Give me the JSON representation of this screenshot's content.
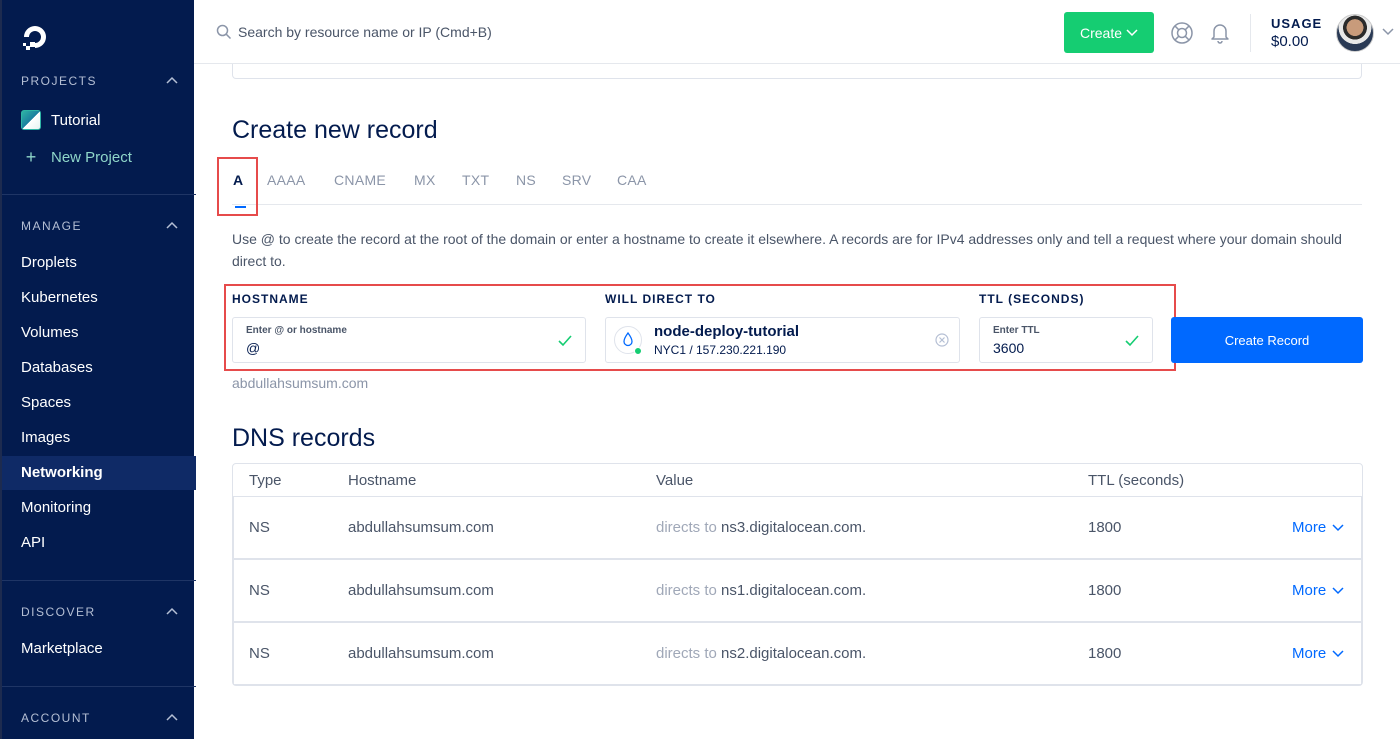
{
  "sidebar": {
    "projects_header": "PROJECTS",
    "project_name": "Tutorial",
    "new_project": "New Project",
    "manage_header": "MANAGE",
    "manage_items": [
      "Droplets",
      "Kubernetes",
      "Volumes",
      "Databases",
      "Spaces",
      "Images",
      "Networking",
      "Monitoring",
      "API"
    ],
    "active_item": "Networking",
    "discover_header": "DISCOVER",
    "discover_items": [
      "Marketplace"
    ],
    "account_header": "ACCOUNT"
  },
  "topbar": {
    "search_placeholder": "Search by resource name or IP (Cmd+B)",
    "create_label": "Create",
    "usage_label": "USAGE",
    "usage_value": "$0.00"
  },
  "create_record": {
    "title": "Create new record",
    "tabs": [
      "A",
      "AAAA",
      "CNAME",
      "MX",
      "TXT",
      "NS",
      "SRV",
      "CAA"
    ],
    "active_tab": "A",
    "description": "Use @ to create the record at the root of the domain or enter a hostname to create it elsewhere. A records are for IPv4 addresses only and tell a request where your domain should direct to.",
    "hostname_label": "HOSTNAME",
    "hostname_small": "Enter @ or hostname",
    "hostname_value": "@",
    "direct_label": "WILL DIRECT TO",
    "droplet_name": "node-deploy-tutorial",
    "droplet_sub": "NYC1 / 157.230.221.190",
    "ttl_label": "TTL (SECONDS)",
    "ttl_small": "Enter TTL",
    "ttl_value": "3600",
    "button_label": "Create Record",
    "domain_hint": "abdullahsumsum.com"
  },
  "dns_records": {
    "title": "DNS records",
    "headers": [
      "Type",
      "Hostname",
      "Value",
      "TTL (seconds)"
    ],
    "directs_text": "directs to",
    "more_label": "More",
    "rows": [
      {
        "type": "NS",
        "hostname": "abdullahsumsum.com",
        "value": "ns3.digitalocean.com.",
        "ttl": "1800"
      },
      {
        "type": "NS",
        "hostname": "abdullahsumsum.com",
        "value": "ns1.digitalocean.com.",
        "ttl": "1800"
      },
      {
        "type": "NS",
        "hostname": "abdullahsumsum.com",
        "value": "ns2.digitalocean.com.",
        "ttl": "1800"
      }
    ]
  },
  "colors": {
    "sidebar_bg": "#031b4e",
    "accent_blue": "#0069ff",
    "create_green": "#15cd72",
    "highlight_red": "#e64b4b"
  }
}
